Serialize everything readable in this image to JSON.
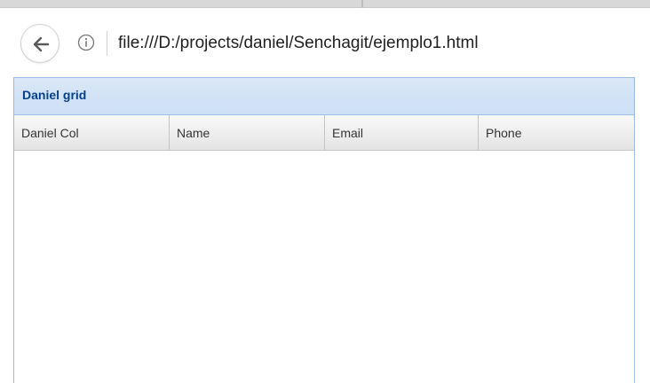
{
  "browser": {
    "url": "file:///D:/projects/daniel/Senchagit/ejemplo1.html",
    "back_icon": "arrow-left-icon",
    "info_icon": "info-circle-icon"
  },
  "grid": {
    "title": "Daniel grid",
    "columns": [
      {
        "label": "Daniel Col"
      },
      {
        "label": "Name"
      },
      {
        "label": "Email"
      },
      {
        "label": "Phone"
      }
    ],
    "rows": [],
    "colors": {
      "header_bg": "#cde0f6",
      "title_text": "#04408c",
      "border": "#99bce8"
    }
  }
}
